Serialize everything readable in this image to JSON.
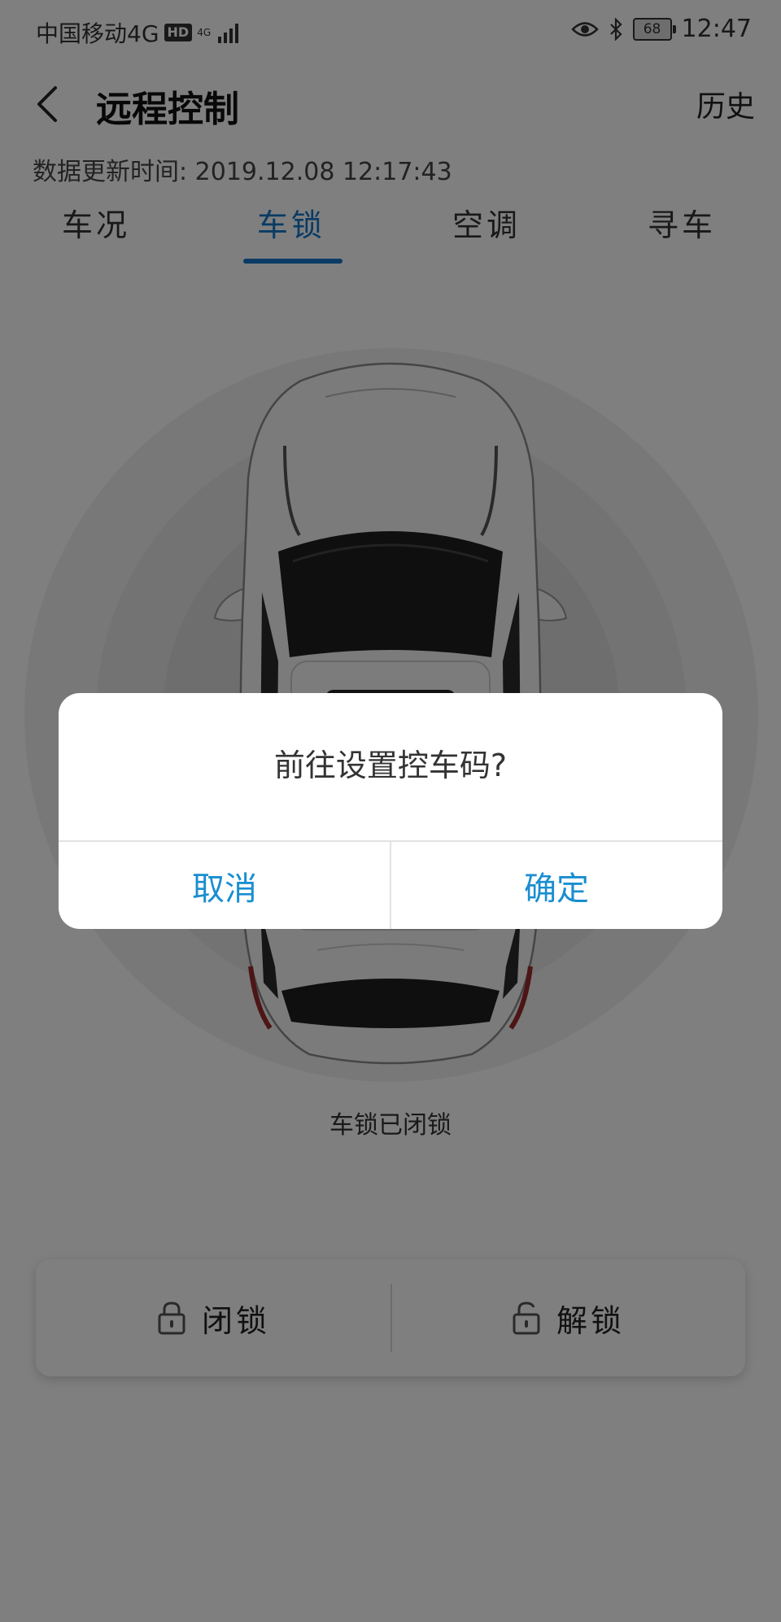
{
  "status_bar": {
    "carrier": "中国移动4G",
    "hd": "HD",
    "network": "4G",
    "battery": "68",
    "time": "12:47"
  },
  "header": {
    "title": "远程控制",
    "history": "历史"
  },
  "update_time": "数据更新时间: 2019.12.08 12:17:43",
  "tabs": [
    {
      "label": "车况",
      "active": false
    },
    {
      "label": "车锁",
      "active": true
    },
    {
      "label": "空调",
      "active": false
    },
    {
      "label": "寻车",
      "active": false
    }
  ],
  "lock_status": "车锁已闭锁",
  "controls": {
    "lock_label": "闭锁",
    "unlock_label": "解锁"
  },
  "dialog": {
    "message": "前往设置控车码?",
    "cancel": "取消",
    "confirm": "确定"
  },
  "colors": {
    "accent": "#1577c9",
    "dialog_button": "#1a8ed0",
    "overlay": "rgba(0,0,0,0.5)"
  }
}
